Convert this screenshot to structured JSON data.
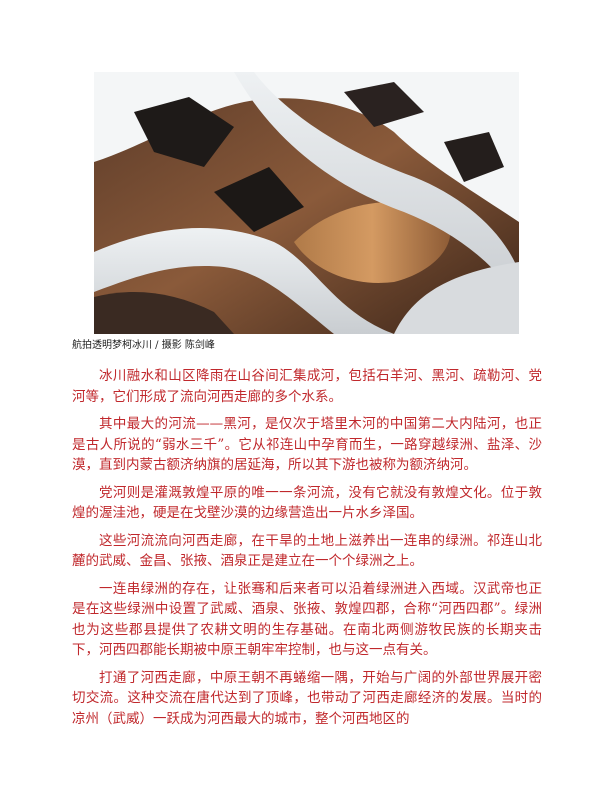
{
  "figure": {
    "caption": "航拍透明梦柯冰川 / 摄影 陈剑峰"
  },
  "paragraphs": [
    "冰川融水和山区降雨在山谷间汇集成河，包括石羊河、黑河、疏勒河、党河等，它们形成了流向河西走廊的多个水系。",
    "其中最大的河流——黑河，是仅次于塔里木河的中国第二大内陆河，也正是古人所说的“弱水三千”。它从祁连山中孕育而生，一路穿越绿洲、盐泽、沙漠，直到内蒙古额济纳旗的居延海，所以其下游也被称为额济纳河。",
    "党河则是灌溉敦煌平原的唯一一条河流，没有它就没有敦煌文化。位于敦煌的渥洼池，硬是在戈壁沙漠的边缘营造出一片水乡泽国。",
    "这些河流流向河西走廊，在干旱的土地上滋养出一连串的绿洲。祁连山北麓的武威、金昌、张掖、酒泉正是建立在一个个绿洲之上。",
    "一连串绿洲的存在，让张骞和后来者可以沿着绿洲进入西域。汉武帝也正是在这些绿洲中设置了武威、酒泉、张掖、敦煌四郡，合称“河西四郡”。绿洲也为这些郡县提供了农耕文明的生存基础。在南北两侧游牧民族的长期夹击下，河西四郡能长期被中原王朝牢牢控制，也与这一点有关。",
    "打通了河西走廊，中原王朝不再蜷缩一隅，开始与广阔的外部世界展开密切交流。这种交流在唐代达到了顶峰，也带动了河西走廊经济的发展。当时的凉州（武威）一跃成为河西最大的城市，整个河西地区的"
  ]
}
